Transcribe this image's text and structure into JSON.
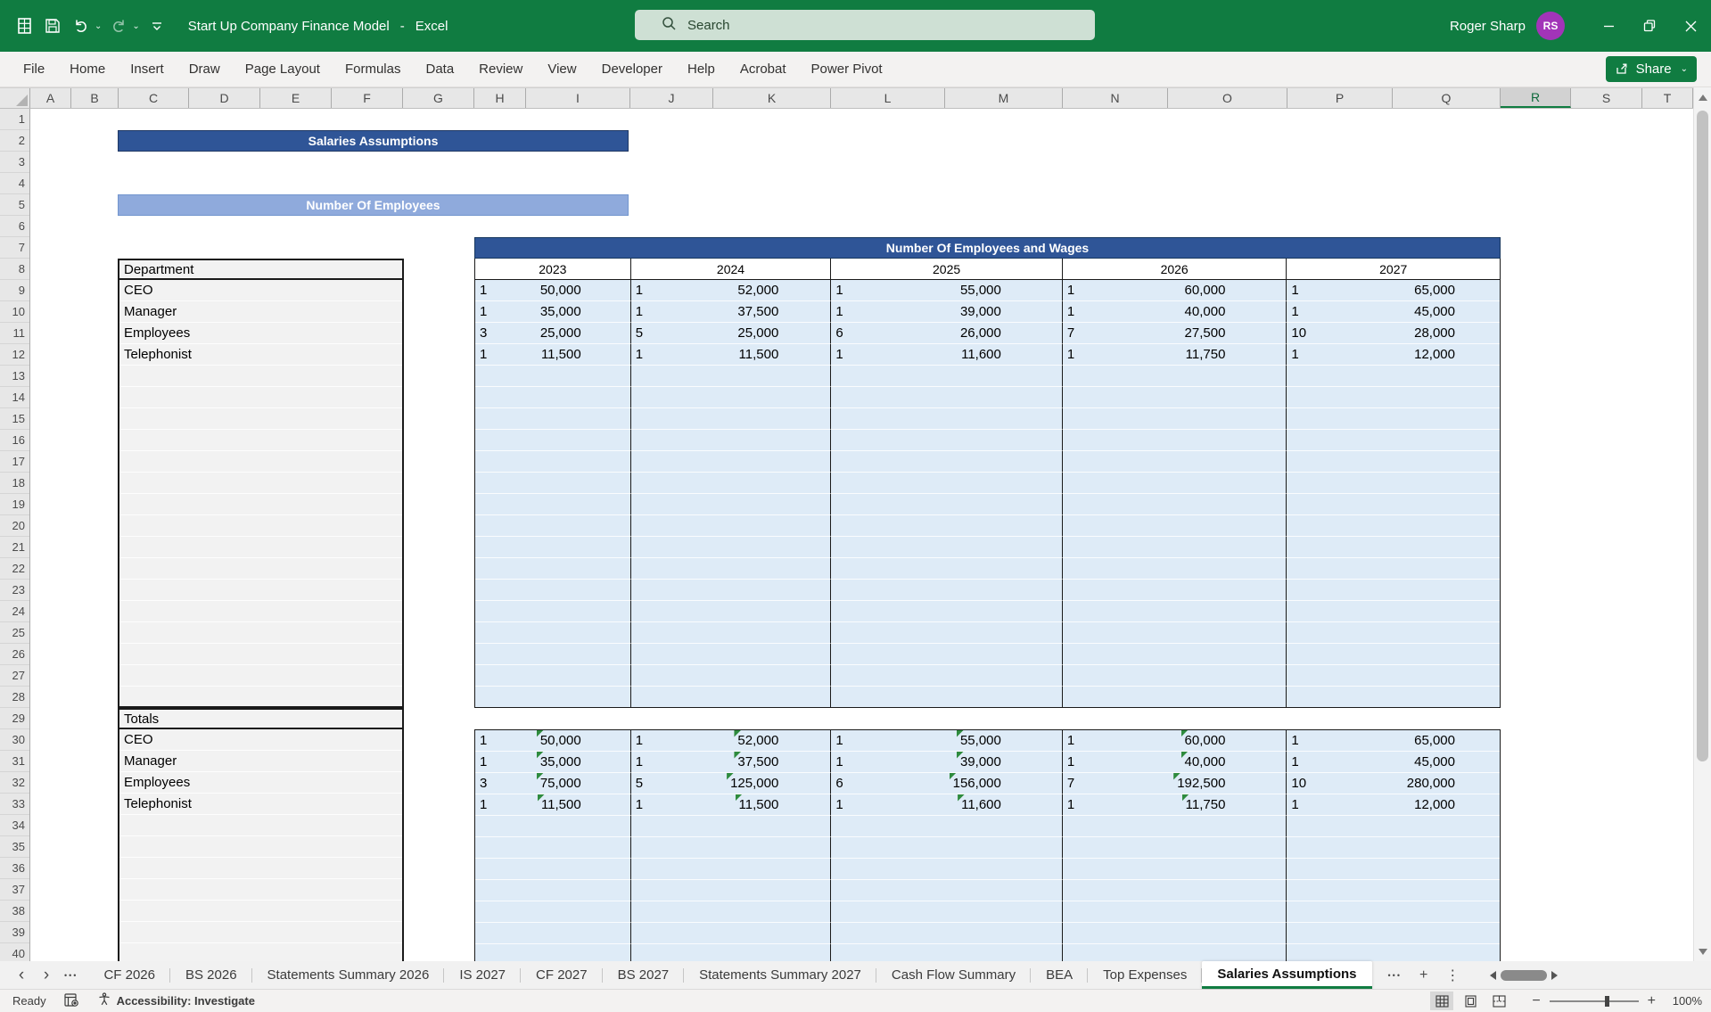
{
  "titlebar": {
    "document_name": "Start Up Company Finance Model",
    "separator": "-",
    "app_name": "Excel",
    "search_placeholder": "Search",
    "user_name": "Roger Sharp",
    "user_initials": "RS"
  },
  "ribbon": {
    "tabs": [
      "File",
      "Home",
      "Insert",
      "Draw",
      "Page Layout",
      "Formulas",
      "Data",
      "Review",
      "View",
      "Developer",
      "Help",
      "Acrobat",
      "Power Pivot"
    ],
    "share_label": "Share"
  },
  "grid": {
    "column_headers": [
      "A",
      "B",
      "C",
      "D",
      "E",
      "F",
      "G",
      "H",
      "I",
      "J",
      "K",
      "L",
      "M",
      "N",
      "O",
      "P",
      "Q",
      "R",
      "S",
      "T"
    ],
    "selected_column": "R",
    "row_numbers_first": 1,
    "row_numbers_last": 40
  },
  "sheet": {
    "banner1": "Salaries Assumptions",
    "banner2": "Number Of Employees",
    "dept_table": {
      "header": "Department",
      "rows": [
        "CEO",
        "Manager",
        "Employees",
        "Telephonist"
      ]
    },
    "totals_table": {
      "header": "Totals",
      "rows": [
        "CEO",
        "Manager",
        "Employees",
        "Telephonist"
      ]
    },
    "wages_table": {
      "title": "Number Of Employees and Wages",
      "years": [
        "2023",
        "2024",
        "2025",
        "2026",
        "2027"
      ],
      "assumptions": [
        {
          "dept": "CEO",
          "values": [
            [
              "1",
              "50,000"
            ],
            [
              "1",
              "52,000"
            ],
            [
              "1",
              "55,000"
            ],
            [
              "1",
              "60,000"
            ],
            [
              "1",
              "65,000"
            ]
          ]
        },
        {
          "dept": "Manager",
          "values": [
            [
              "1",
              "35,000"
            ],
            [
              "1",
              "37,500"
            ],
            [
              "1",
              "39,000"
            ],
            [
              "1",
              "40,000"
            ],
            [
              "1",
              "45,000"
            ]
          ]
        },
        {
          "dept": "Employees",
          "values": [
            [
              "3",
              "25,000"
            ],
            [
              "5",
              "25,000"
            ],
            [
              "6",
              "26,000"
            ],
            [
              "7",
              "27,500"
            ],
            [
              "10",
              "28,000"
            ]
          ]
        },
        {
          "dept": "Telephonist",
          "values": [
            [
              "1",
              "11,500"
            ],
            [
              "1",
              "11,500"
            ],
            [
              "1",
              "11,600"
            ],
            [
              "1",
              "11,750"
            ],
            [
              "1",
              "12,000"
            ]
          ]
        }
      ],
      "totals": [
        {
          "dept": "CEO",
          "values": [
            [
              "1",
              "50,000",
              true
            ],
            [
              "1",
              "52,000",
              true
            ],
            [
              "1",
              "55,000",
              true
            ],
            [
              "1",
              "60,000",
              true
            ],
            [
              "1",
              "65,000",
              false
            ]
          ]
        },
        {
          "dept": "Manager",
          "values": [
            [
              "1",
              "35,000",
              true
            ],
            [
              "1",
              "37,500",
              true
            ],
            [
              "1",
              "39,000",
              true
            ],
            [
              "1",
              "40,000",
              true
            ],
            [
              "1",
              "45,000",
              false
            ]
          ]
        },
        {
          "dept": "Employees",
          "values": [
            [
              "3",
              "75,000",
              true
            ],
            [
              "5",
              "125,000",
              true
            ],
            [
              "6",
              "156,000",
              true
            ],
            [
              "7",
              "192,500",
              true
            ],
            [
              "10",
              "280,000",
              false
            ]
          ]
        },
        {
          "dept": "Telephonist",
          "values": [
            [
              "1",
              "11,500",
              true
            ],
            [
              "1",
              "11,500",
              true
            ],
            [
              "1",
              "11,600",
              true
            ],
            [
              "1",
              "11,750",
              true
            ],
            [
              "1",
              "12,000",
              false
            ]
          ]
        }
      ]
    }
  },
  "tabbar": {
    "nav_icons": {
      "prev": "‹",
      "next": "›",
      "more": "•••",
      "overflow": "•••",
      "add": "+",
      "menu": "⋮"
    },
    "tabs": [
      "CF 2026",
      "BS 2026",
      "Statements Summary 2026",
      "IS 2027",
      "CF 2027",
      "BS 2027",
      "Statements Summary 2027",
      "Cash Flow Summary",
      "BEA",
      "Top Expenses",
      "Salaries Assumptions"
    ],
    "active_tab": "Salaries Assumptions"
  },
  "statusbar": {
    "ready": "Ready",
    "accessibility": "Accessibility: Investigate",
    "zoom_level": "100%"
  },
  "colors": {
    "accent_green": "#107C41",
    "banner_dark_blue": "#2F5597",
    "banner_light_blue": "#8FAADC",
    "table_blue": "#DEEBF7",
    "table_gray": "#F2F2F2",
    "avatar_purple": "#A234B8",
    "error_triangle_green": "#2E8B3E"
  }
}
